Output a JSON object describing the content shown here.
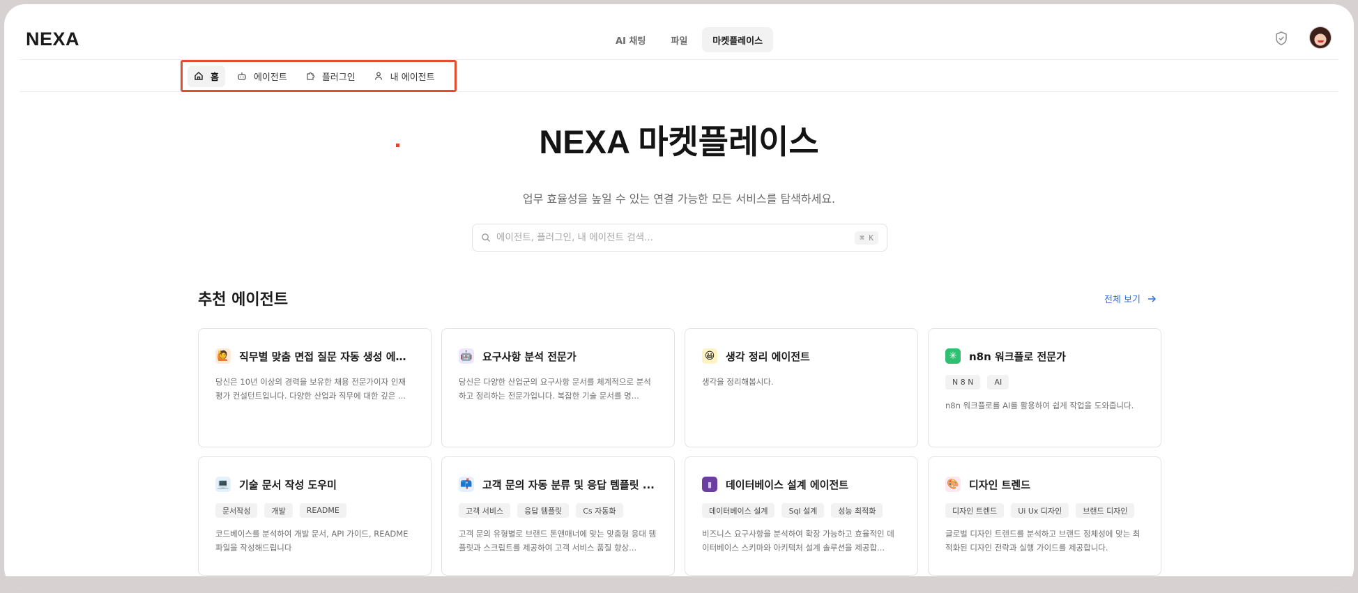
{
  "app": {
    "logo": "NEXA"
  },
  "top_nav": {
    "tabs": [
      {
        "label": "AI 채팅",
        "active": false
      },
      {
        "label": "파일",
        "active": false
      },
      {
        "label": "마켓플레이스",
        "active": true
      }
    ]
  },
  "sub_nav": {
    "items": [
      {
        "label": "홈",
        "icon": "home-icon",
        "active": true
      },
      {
        "label": "에이전트",
        "icon": "bot-icon",
        "active": false
      },
      {
        "label": "플러그인",
        "icon": "puzzle-icon",
        "active": false
      },
      {
        "label": "내 에이전트",
        "icon": "user-icon",
        "active": false
      }
    ]
  },
  "hero": {
    "title": "NEXA 마켓플레이스",
    "subtitle": "업무 효율성을 높일 수 있는 연결 가능한 모든 서비스를 탐색하세요."
  },
  "search": {
    "placeholder": "에이전트, 플러그인, 내 에이전트 검색...",
    "value": "",
    "shortcut": "⌘ K"
  },
  "section": {
    "title": "추천 에이전트",
    "view_all": "전체 보기"
  },
  "cards": [
    {
      "icon": "🙋",
      "icon_bg": "#ffe9d6",
      "title": "직무별 맞춤 면접 질문 자동 생성 에이...",
      "tags": [],
      "desc": "당신은 10년 이상의 경력을 보유한 채용 전문가이자 인재 평가 컨설턴트입니다. 다양한 산업과 직무에 대한 깊은 ..."
    },
    {
      "icon": "🤖",
      "icon_bg": "#ece6ff",
      "title": "요구사항 분석 전문가",
      "tags": [],
      "desc": "당신은 다양한 산업군의 요구사항 문서를 체계적으로 분석하고 정리하는 전문가입니다. 복잡한 기술 문서를 명..."
    },
    {
      "icon": "😀",
      "icon_bg": "#fff3c4",
      "title": "생각 정리 에이전트",
      "tags": [],
      "desc": "생각을 정리해봅시다."
    },
    {
      "icon": "✳",
      "icon_bg": "#2fbf71",
      "title": "n8n 워크플로 전문가",
      "tags": [
        "N 8 N",
        "AI"
      ],
      "desc": "n8n 워크플로를 AI를 활용하여 쉽게 작업을 도와줍니다."
    },
    {
      "icon": "💻",
      "icon_bg": "#e4f1fb",
      "title": "기술 문서 작성 도우미",
      "tags": [
        "문서작성",
        "개발",
        "README"
      ],
      "desc": "코드베이스를 분석하여 개발 문서, API 가이드, README 파일을 작성해드립니다"
    },
    {
      "icon": "📫",
      "icon_bg": "#e6eefc",
      "title": "고객 문의 자동 분류 및 응답 템플릿 ...",
      "tags": [
        "고객 서비스",
        "응답 템플릿",
        "Cs 자동화"
      ],
      "desc": "고객 문의 유형별로 브랜드 톤앤매너에 맞는 맞춤형 응대 템플릿과 스크립트를 제공하여 고객 서비스 품질 향상..."
    },
    {
      "icon": "▮",
      "icon_bg": "#6b3fa0",
      "title": "데이터베이스 설계 에이전트",
      "tags": [
        "데이터베이스 설계",
        "Sql 설계",
        "성능 최적화"
      ],
      "desc": "비즈니스 요구사항을 분석하여 확장 가능하고 효율적인 데이터베이스 스키마와 아키텍처 설계 솔루션을 제공합..."
    },
    {
      "icon": "🎨",
      "icon_bg": "#fde8ee",
      "title": "디자인 트렌드",
      "tags": [
        "디자인 트렌드",
        "Ui Ux 디자인",
        "브랜드 디자인"
      ],
      "desc": "글로벌 디자인 트렌드를 분석하고 브랜드 정체성에 맞는 최적화된 디자인 전략과 실행 가이드를 제공합니다."
    }
  ],
  "colors": {
    "accent_link": "#2f6fd6",
    "highlight": "#cdeec0",
    "annotation_box": "#e24e2b"
  }
}
